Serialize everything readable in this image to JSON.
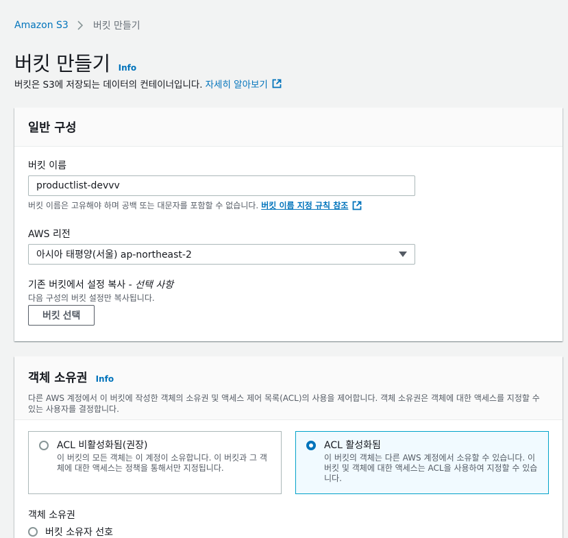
{
  "breadcrumb": {
    "root": "Amazon S3",
    "current": "버킷 만들기"
  },
  "page": {
    "title": "버킷 만들기",
    "info": "Info",
    "description": "버킷은 S3에 저장되는 데이터의 컨테이너입니다.",
    "learn_more": "자세히 알아보기"
  },
  "general": {
    "title": "일반 구성",
    "bucket_name_label": "버킷 이름",
    "bucket_name_value": "productlist-devvv",
    "bucket_name_hint": "버킷 이름은 고유해야 하며 공백 또는 대문자를 포함할 수 없습니다.",
    "bucket_name_rules_link": "버킷 이름 지정 규칙 참조",
    "region_label": "AWS 리전",
    "region_value": "아시아 태평양(서울) ap-northeast-2",
    "copy_label": "기존 버킷에서 설정 복사 - ",
    "copy_optional": "선택 사항",
    "copy_hint": "다음 구성의 버킷 설정만 복사됩니다.",
    "choose_bucket_button": "버킷 선택"
  },
  "ownership": {
    "title": "객체 소유권",
    "info": "Info",
    "description": "다른 AWS 계정에서 이 버킷에 작성한 객체의 소유권 및 액세스 제어 목록(ACL)의 사용을 제어합니다. 객체 소유권은 객체에 대한 액세스를 지정할 수 있는 사용자를 결정합니다.",
    "acl_disabled_title": "ACL 비활성화됨(권장)",
    "acl_disabled_desc": "이 버킷의 모든 객체는 이 계정이 소유합니다. 이 버킷과 그 객체에 대한 액세스는 정책을 통해서만 지정됩니다.",
    "acl_enabled_title": "ACL 활성화됨",
    "acl_enabled_desc": "이 버킷의 객체는 다른 AWS 계정에서 소유할 수 있습니다. 이 버킷 및 객체에 대한 액세스는 ACL을 사용하여 지정할 수 있습니다.",
    "owner_label": "객체 소유권",
    "owner_option_1": "버킷 소유자 선호"
  },
  "colors": {
    "link": "#0073bb",
    "selected_tile_bg": "#f1faff",
    "selected_tile_border": "#00a1c9"
  }
}
